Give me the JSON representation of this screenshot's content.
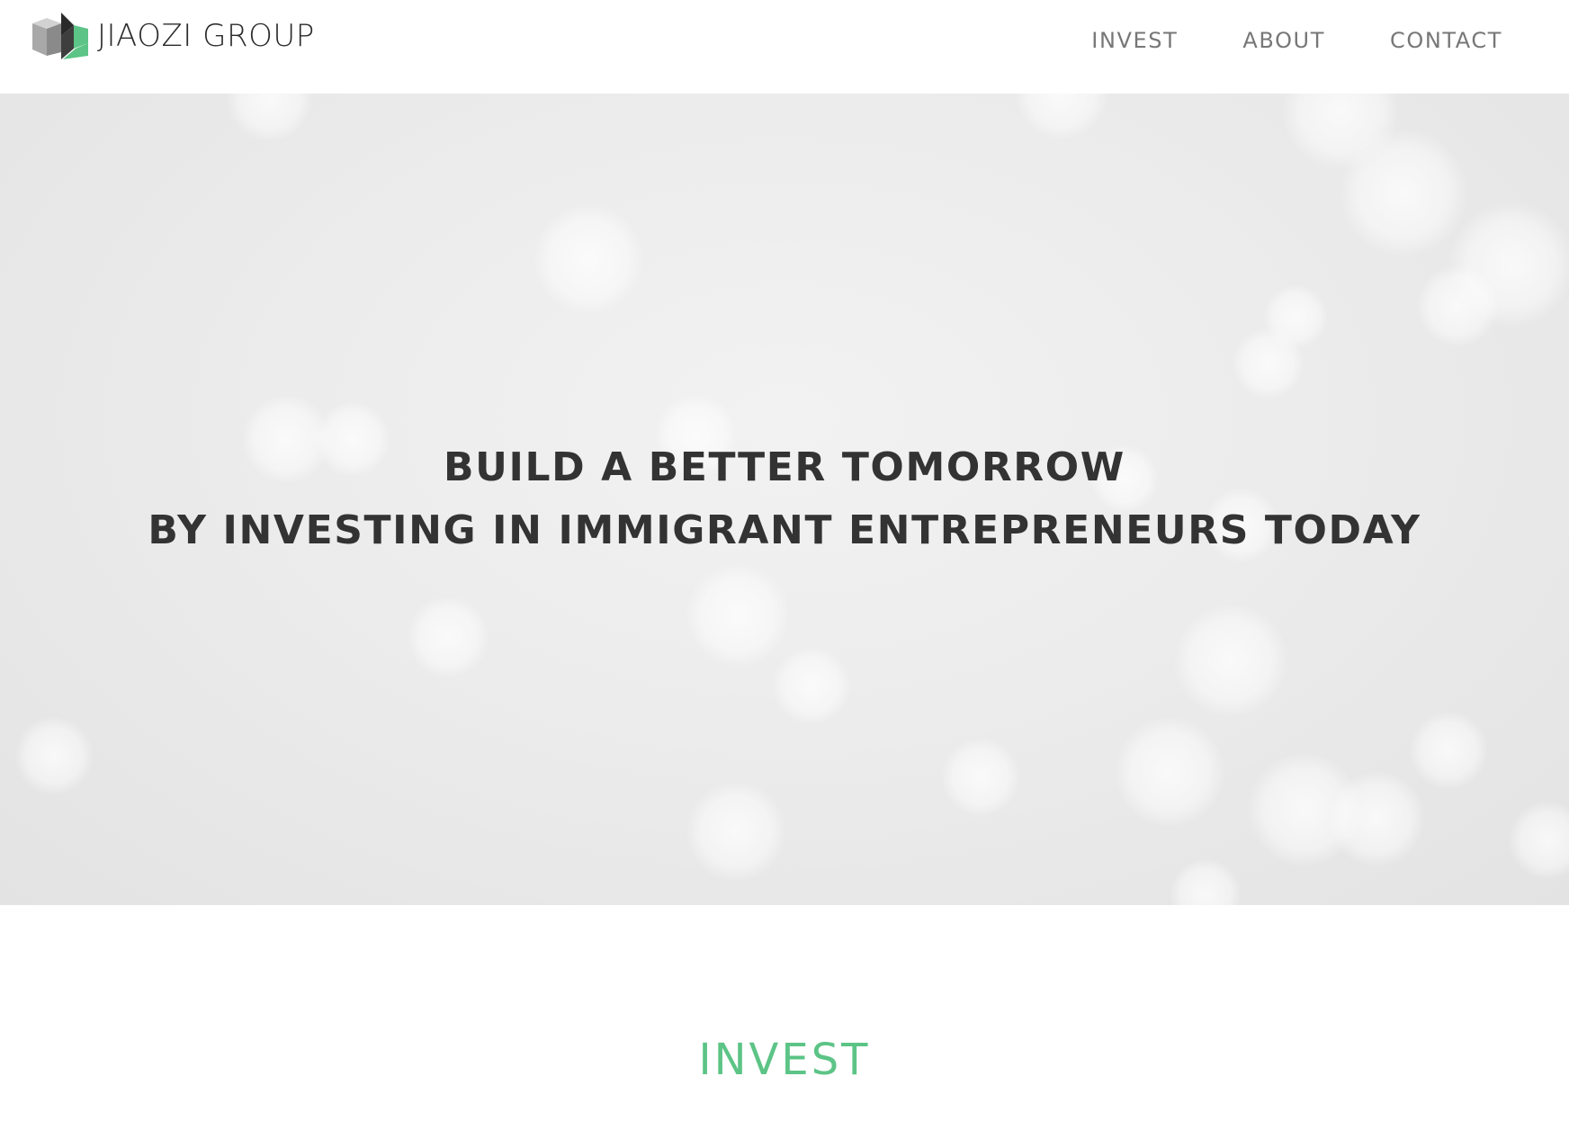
{
  "brand": {
    "name": "JIAOZI GROUP",
    "logo_icon": "cube-logo-icon",
    "accent_color": "#5cc486"
  },
  "nav": {
    "items": [
      {
        "label": "INVEST"
      },
      {
        "label": "ABOUT"
      },
      {
        "label": "CONTACT"
      }
    ]
  },
  "hero": {
    "line1": "BUILD A BETTER TOMORROW",
    "line2": "BY INVESTING IN IMMIGRANT ENTREPRENEURS TODAY"
  },
  "invest_section": {
    "heading": "INVEST",
    "heading_color": "#5cc486"
  }
}
